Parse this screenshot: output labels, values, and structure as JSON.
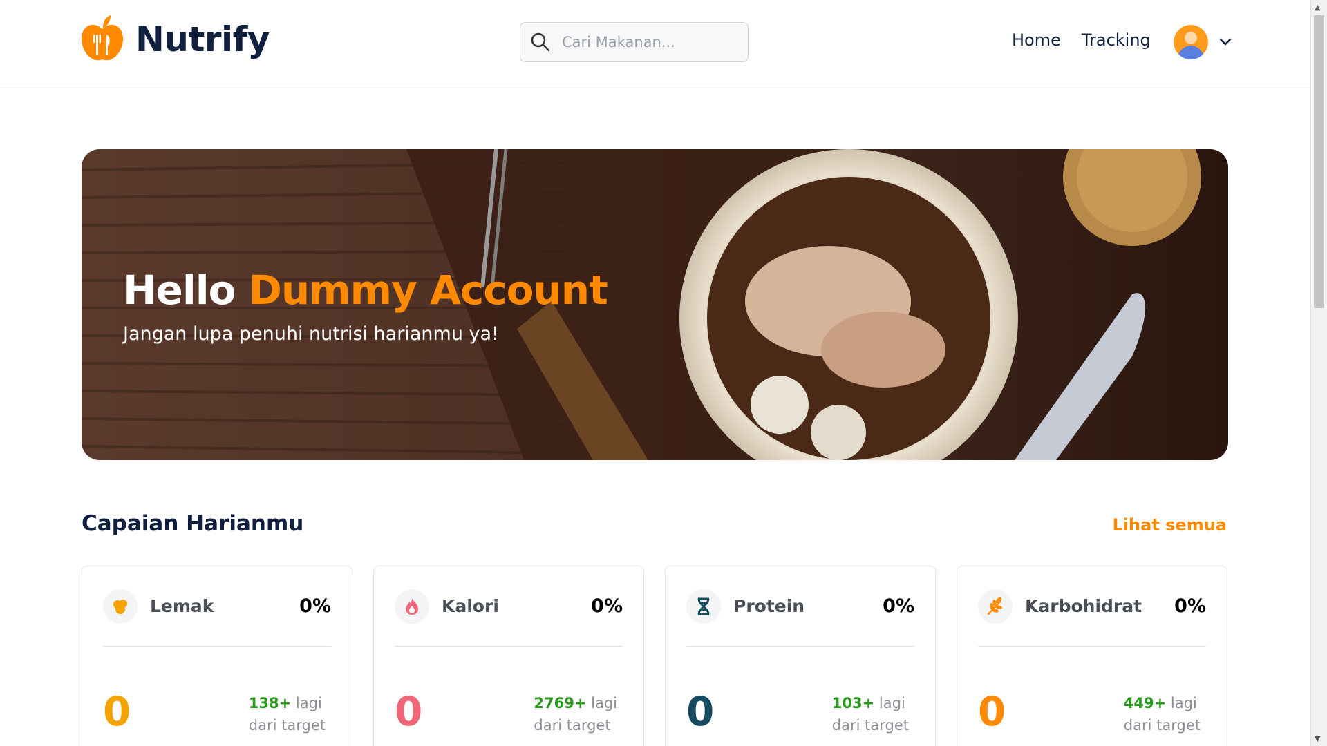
{
  "navbar": {
    "brand_name": "Nutrify",
    "search_placeholder": "Cari Makanan...",
    "links": [
      "Home",
      "Tracking"
    ]
  },
  "hero": {
    "greeting": "Hello",
    "user_name": "Dummy Account",
    "subtitle": "Jangan lupa penuhi nutrisi harianmu ya!"
  },
  "section": {
    "title": "Capaian Harianmu",
    "see_all": "Lihat semua"
  },
  "cards": [
    {
      "label": "Lemak",
      "percent": "0%",
      "value": "0",
      "remaining": "138+",
      "suffix": "lagi",
      "suffix2": "dari target",
      "value_color": "#f5a300",
      "icon": "fat-icon"
    },
    {
      "label": "Kalori",
      "percent": "0%",
      "value": "0",
      "remaining": "2769+",
      "suffix": "lagi",
      "suffix2": "dari target",
      "value_color": "#f06679",
      "icon": "flame-icon"
    },
    {
      "label": "Protein",
      "percent": "0%",
      "value": "0",
      "remaining": "103+",
      "suffix": "lagi",
      "suffix2": "dari target",
      "value_color": "#164b60",
      "icon": "dna-icon"
    },
    {
      "label": "Karbohidrat",
      "percent": "0%",
      "value": "0",
      "remaining": "449+",
      "suffix": "lagi",
      "suffix2": "dari target",
      "value_color": "#ff8a00",
      "icon": "wheat-icon"
    }
  ],
  "colors": {
    "accent": "#ff8a00",
    "navy": "#0f1f3d",
    "green": "#2a9a1e"
  }
}
